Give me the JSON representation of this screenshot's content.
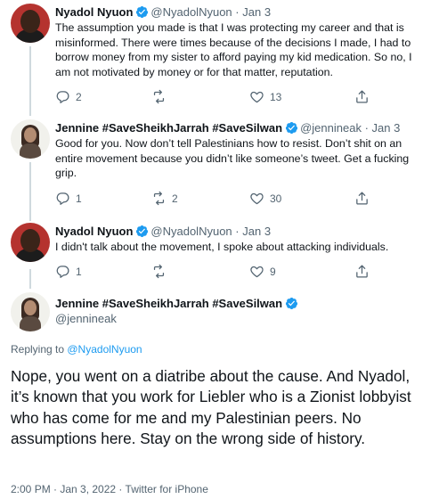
{
  "tweets": [
    {
      "author": "Nyadol Nyuon",
      "handle": "@NyadolNyuon",
      "sep": "·",
      "date": "Jan 3",
      "text": "The assumption you made is that I was protecting my career and that is misinformed. There were times because of the decisions I made, I had to borrow money from my sister to afford paying my kid medication. So no, I am not motivated by money or for that matter, reputation.",
      "replies": "2",
      "retweets": "",
      "likes": "13"
    },
    {
      "author": "Jennine #SaveSheikhJarrah #SaveSilwan",
      "handle": "@jennineak",
      "sep": "·",
      "date": "Jan 3",
      "text": "Good for you. Now don’t tell Palestinians how to resist. Don’t shit on an entire movement because you didn’t like someone’s tweet. Get a fucking grip.",
      "replies": "1",
      "retweets": "2",
      "likes": "30"
    },
    {
      "author": "Nyadol Nyuon",
      "handle": "@NyadolNyuon",
      "sep": "·",
      "date": "Jan 3",
      "text": "I didn't talk about the movement, I spoke about attacking individuals.",
      "replies": "1",
      "retweets": "",
      "likes": "9"
    }
  ],
  "main": {
    "author": "Jennine #SaveSheikhJarrah #SaveSilwan",
    "handle": "@jennineak",
    "replying_prefix": "Replying to ",
    "replying_to": "@NyadolNyuon",
    "text": "Nope, you went on a diatribe about the cause. And Nyadol, it’s known that you work for Liebler who is a Zionist lobbyist who has come for me and my Palestinian peers. No assumptions here. Stay on the wrong side of history.",
    "meta": "2:00 PM · Jan 3, 2022 · Twitter for iPhone"
  },
  "icons": [
    "verified-badge-icon",
    "reply-icon",
    "retweet-icon",
    "like-icon",
    "share-icon"
  ],
  "colors": {
    "accent": "#1d9bf0",
    "secondary_text": "#536471",
    "thread_line": "#cfd9de"
  }
}
